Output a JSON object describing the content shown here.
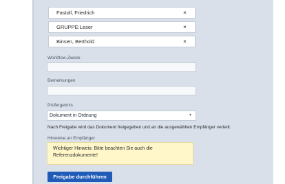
{
  "recipients": [
    {
      "name": "Fastoll, Friedrich",
      "remove": "×"
    },
    {
      "name": "GRUPPE:Leser",
      "remove": "×"
    },
    {
      "name": "Binsen, Berthold",
      "remove": "×"
    }
  ],
  "workflow_purpose": {
    "label": "Workflow-Zweck",
    "value": ""
  },
  "remarks": {
    "label": "Bemerkungen",
    "value": ""
  },
  "review_result": {
    "label": "Prüfergebnis",
    "selected": "Dokument in Ordnung",
    "caret": "▾"
  },
  "info_text": "Nach Freigabe wird das Dokument freigegeben und an die ausgewählten Empfänger verteilt.",
  "note": {
    "label": "Hinweise an Empfänger",
    "line1": "Wichtiger Hinweis: Bitte beachten Sie auch die",
    "line2": "Referenzdokumente!"
  },
  "submit_label": "Freigabe durchführen",
  "colors": {
    "panel": "#d9e0ea",
    "primary": "#1f5bb7",
    "note_bg": "#fff6c9"
  }
}
